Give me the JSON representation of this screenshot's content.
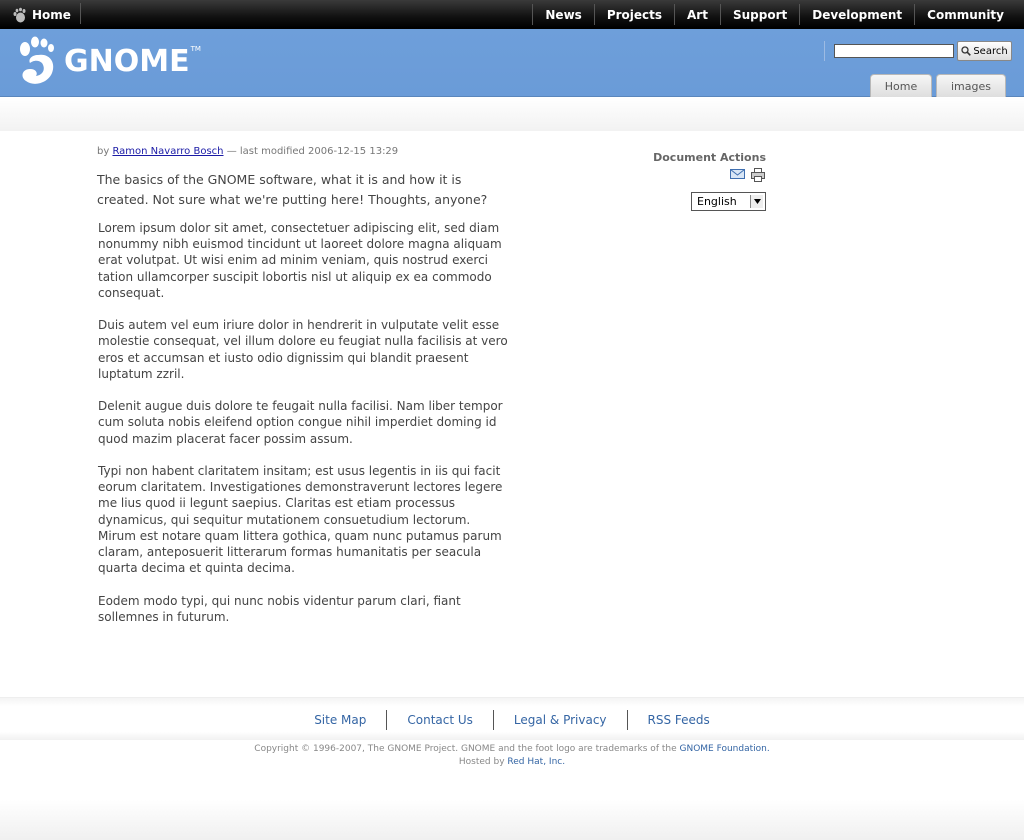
{
  "topbar": {
    "home_label": "Home",
    "nav": [
      "News",
      "Projects",
      "Art",
      "Support",
      "Development",
      "Community"
    ]
  },
  "header": {
    "logo_text": "GNOME",
    "logo_tm": "TM",
    "search": {
      "value": "",
      "button_label": "Search"
    },
    "tabs": [
      "Home",
      "images"
    ]
  },
  "document": {
    "by_prefix": "by",
    "author": "Ramon Navarro Bosch",
    "modified": "— last modified 2006-12-15 13:29",
    "description": "The basics of the GNOME software, what it is and how it is created. Not sure what we're putting here! Thoughts, anyone?",
    "paragraphs": [
      "Lorem ipsum dolor sit amet, consectetuer adipiscing elit, sed diam nonummy nibh euismod tincidunt ut laoreet dolore magna aliquam  erat volutpat. Ut wisi enim ad minim veniam, quis nostrud exerci tation ullamcorper suscipit lobortis nisl ut aliquip ex ea commodo consequat.",
      "Duis autem vel eum iriure dolor in hendrerit in vulputate velit esse molestie consequat, vel illum dolore eu feugiat nulla facilisis at vero eros et accumsan et iusto odio dignissim qui blandit praesent luptatum zzril.",
      "Delenit augue duis dolore te feugait nulla facilisi. Nam liber tempor cum soluta nobis eleifend option congue nihil imperdiet doming id quod mazim placerat facer possim assum.",
      "Typi non habent claritatem insitam; est usus legentis in iis qui facit eorum claritatem. Investigationes demonstraverunt lectores legere me lius quod ii legunt saepius. Claritas est etiam processus dynamicus, qui sequitur mutationem consuetudium lectorum. Mirum est notare quam littera gothica, quam nunc putamus parum claram, anteposuerit litterarum formas humanitatis per seacula quarta decima et quinta decima.",
      "Eodem modo typi, qui nunc nobis videntur parum clari, fiant sollemnes in futurum."
    ]
  },
  "actions": {
    "title": "Document Actions",
    "icons": [
      "send-to-icon",
      "print-icon"
    ],
    "language": "English"
  },
  "footer": {
    "links": [
      "Site Map",
      "Contact Us",
      "Legal & Privacy",
      "RSS Feeds"
    ],
    "copyright_pre": "Copyright © 1996-2007, The GNOME Project. GNOME and the foot logo are trademarks of the",
    "foundation": "GNOME Foundation.",
    "hosted_pre": "Hosted by",
    "host": "Red Hat, Inc."
  },
  "colors": {
    "header_blue": "#6e9fda",
    "link_blue": "#3465a4",
    "author_link": "#1a1aa6"
  }
}
